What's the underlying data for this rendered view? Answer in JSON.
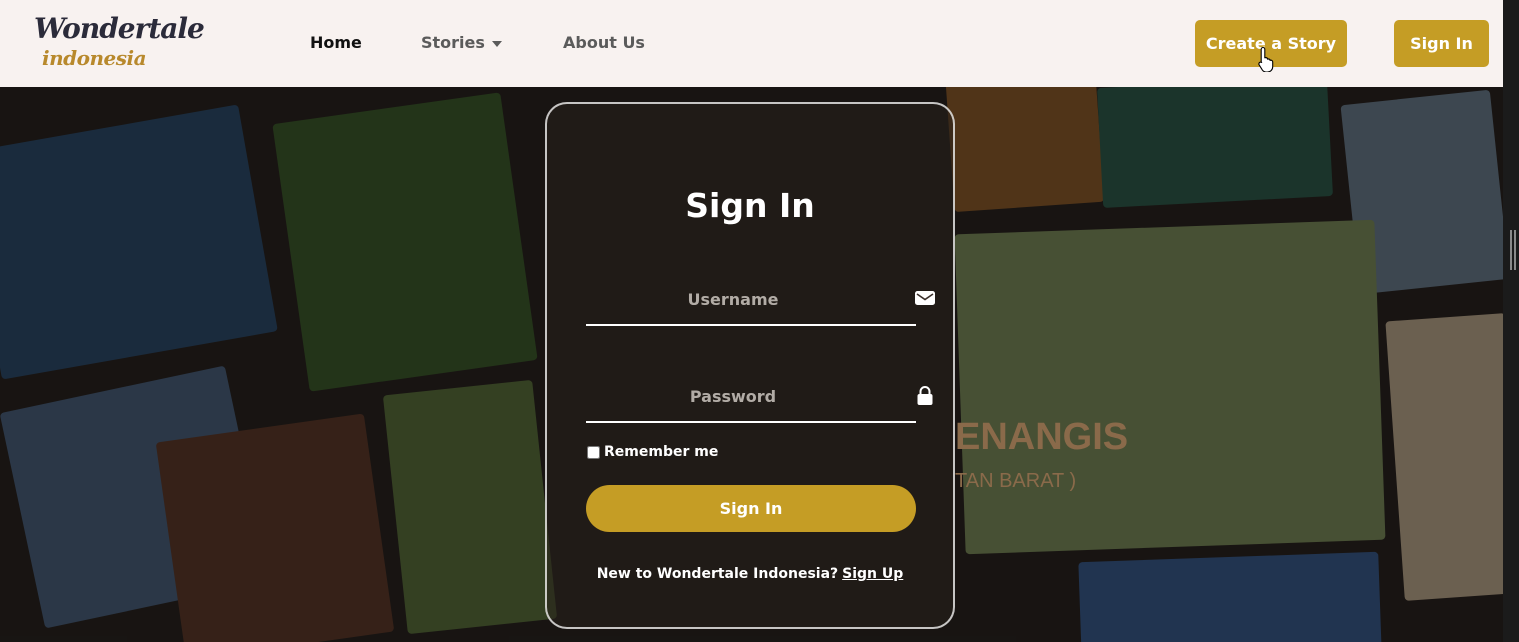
{
  "brand": {
    "logo_line1": "Wondertale",
    "logo_line2": "indonesia"
  },
  "nav": {
    "home": "Home",
    "stories": "Stories",
    "about": "About Us",
    "create_story": "Create a Story",
    "sign_in": "Sign In"
  },
  "login": {
    "title": "Sign In",
    "username_placeholder": "Username",
    "password_placeholder": "Password",
    "remember_label": "Remember me",
    "remember_checked": false,
    "submit": "Sign In",
    "signup_prompt": "New to Wondertale Indonesia?",
    "signup_link": "Sign Up"
  },
  "colors": {
    "accent": "#c59d25",
    "nav_bg": "#f8f2f0"
  },
  "background_text": {
    "poster_main": "ENANGIS",
    "poster_sub": "TAN BARAT )"
  },
  "icons": [
    "mail-icon",
    "lock-icon",
    "chevron-down-icon",
    "pointer-cursor-icon"
  ]
}
